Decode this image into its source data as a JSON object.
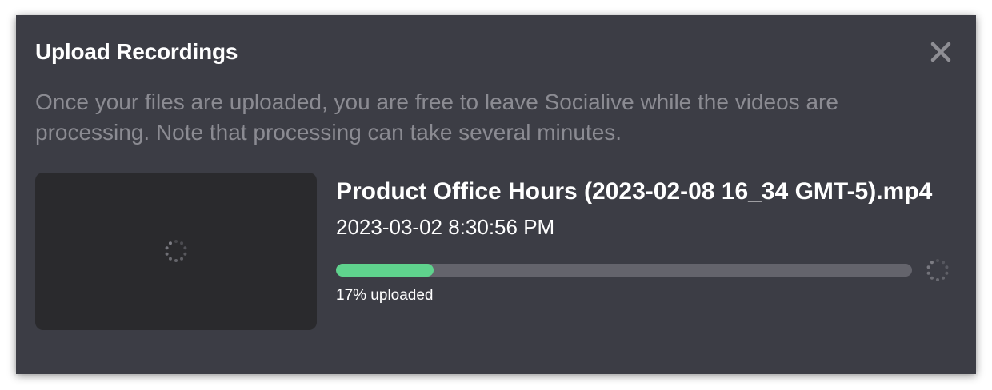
{
  "dialog": {
    "title": "Upload Recordings",
    "close_icon": "close-icon",
    "description": "Once your files are uploaded, you are free to leave Socialive while the videos are processing. Note that processing can take several minutes."
  },
  "upload": {
    "thumbnail_icon": "loading-spinner-icon",
    "file_name": "Product Office Hours (2023-02-08 16_34 GMT-5).mp4",
    "date": "2023-03-02 8:30:56 PM",
    "progress_percent": 17,
    "progress_label": "17% uploaded",
    "status_icon": "loading-spinner-icon"
  },
  "colors": {
    "modal_bg": "#3c3d45",
    "progress_fill": "#5fd38d",
    "progress_track": "#64646c",
    "thumbnail_bg": "#2a2a2d",
    "description_text": "#8b8b92"
  }
}
